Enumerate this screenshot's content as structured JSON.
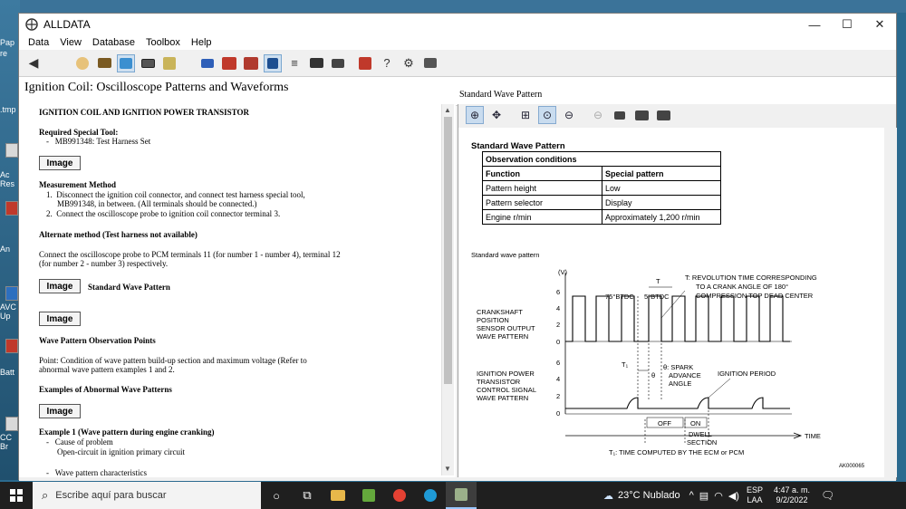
{
  "desktop": {
    "labels": [
      "Pap",
      "re",
      ".tmp",
      "Ac",
      "Res",
      "An",
      "AVC",
      "Up",
      "Batt",
      "CC",
      "Br"
    ]
  },
  "window": {
    "title": "ALLDATA",
    "buttons": {
      "minimize": "—",
      "maximize": "☐",
      "close": "✕"
    }
  },
  "menu": [
    "Data",
    "View",
    "Database",
    "Toolbox",
    "Help"
  ],
  "toolbar": {
    "back_glyph": "◀",
    "tool_icons": [
      "customer-icon",
      "folder-icon",
      "scan-tool-icon",
      "component-icon",
      "diagnostic-icon",
      "tsb-icon",
      "new-car-icon",
      "car-icon",
      "index-icon",
      "list-icon",
      "camera-icon",
      "print-icon",
      "bookmark-icon",
      "help-icon",
      "settings-icon",
      "printer-icon"
    ]
  },
  "document": {
    "title": "Ignition Coil:  Oscilloscope Patterns and Waveforms",
    "pane_label": "Standard Wave Pattern",
    "heading": "IGNITION COIL AND IGNITION POWER TRANSISTOR",
    "required_tool_heading": "Required Special Tool:",
    "required_tool_item": "MB991348: Test Harness Set",
    "image_button": "Image",
    "measurement_heading": "Measurement Method",
    "measurement_1a": "Disconnect the ignition coil connector, and connect test harness special tool,",
    "measurement_1b": "MB991348, in between. (All terminals should be connected.)",
    "measurement_2": "Connect the oscilloscope probe to ignition coil connector terminal 3.",
    "alt_heading": "Alternate method (Test harness not available)",
    "alt_text_a": "Connect the oscilloscope probe to PCM terminals 11 (for number 1 - number 4), terminal 12",
    "alt_text_b": "(for number 2 - number 3) respectively.",
    "standard_wave_label": "Standard Wave Pattern",
    "obs_heading": "Wave Pattern Observation Points",
    "point_a": "Point: Condition of wave pattern build-up section and maximum voltage (Refer to",
    "point_b": "abnormal wave pattern examples 1 and 2.",
    "abnormal_heading": "Examples of Abnormal Wave Patterns",
    "example1_heading": "Example 1 (Wave pattern during engine cranking)",
    "cause_heading": "Cause of problem",
    "cause_text": "Open-circuit in ignition primary circuit",
    "characteristics": "Wave pattern characteristics"
  },
  "viewer": {
    "tool_icons": [
      "zoom-in-icon",
      "pan-icon",
      "zoom-area-icon",
      "zoom-fit-icon",
      "zoom-out-icon",
      "zoom-disabled-icon",
      "print-icon",
      "image-prev-icon",
      "image-next-icon"
    ],
    "table_title": "Standard Wave Pattern",
    "table_header": "Observation conditions",
    "rows": [
      [
        "Function",
        "Special pattern"
      ],
      [
        "Pattern height",
        "Low"
      ],
      [
        "Pattern selector",
        "Display"
      ],
      [
        "Engine r/min",
        "Approximately 1,200 r/min"
      ]
    ],
    "wave_label": "Standard wave pattern",
    "diagram": {
      "unit": "(V)",
      "t_label": "T",
      "t_note_1": "T: REVOLUTION TIME CORRESPONDING",
      "t_note_2": "TO A CRANK ANGLE OF 180°",
      "t_note_3": "COMPRESSION TOP DEAD CENTER",
      "btdc75": "75°BTDC",
      "btdc5": "5°BTDC",
      "crank_1": "CRANKSHAFT",
      "crank_2": "POSITION",
      "crank_3": "SENSOR OUTPUT",
      "crank_4": "WAVE PATTERN",
      "y_ticks": [
        "6",
        "4",
        "2",
        "0"
      ],
      "ign_1": "IGNITION POWER",
      "ign_2": "TRANSISTOR",
      "ign_3": "CONTROL SIGNAL",
      "ign_4": "WAVE PATTERN",
      "t1": "T₁",
      "theta": "θ",
      "spark_1": "θ: SPARK",
      "spark_2": "ADVANCE",
      "spark_3": "ANGLE",
      "ign_period": "IGNITION PERIOD",
      "off": "OFF",
      "on": "ON",
      "dwell_1": "DWELL",
      "dwell_2": "SECTION",
      "time": "TIME",
      "t1_note": "T₁: TIME COMPUTED BY THE ECM or PCM",
      "code": "AK000065"
    }
  },
  "taskbar": {
    "search_placeholder": "Escribe aquí para buscar",
    "weather": "23°C  Nublado",
    "lang_1": "ESP",
    "lang_2": "LAA",
    "time": "4:47 a. m.",
    "date": "9/2/2022"
  }
}
